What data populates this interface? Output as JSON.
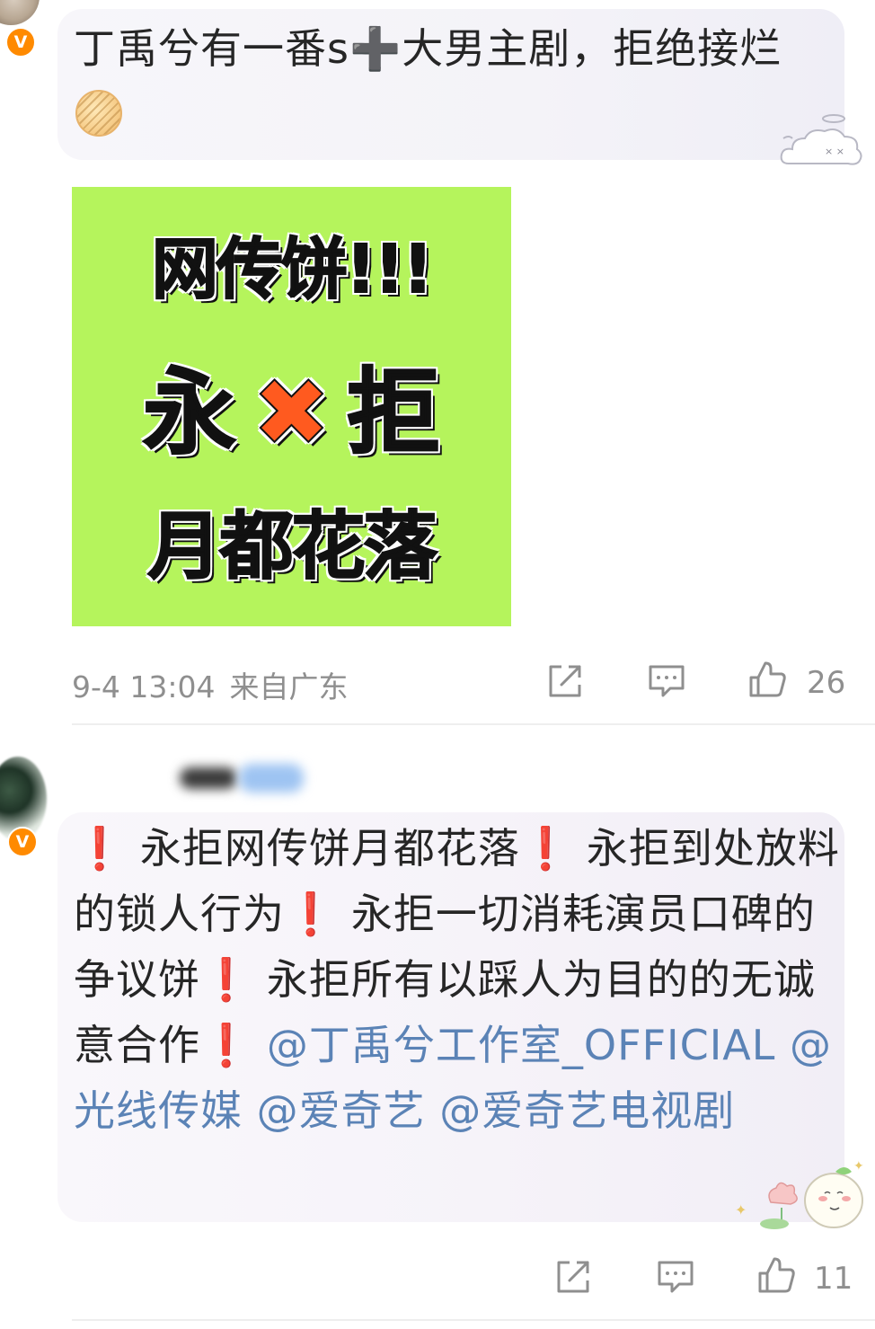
{
  "comments": [
    {
      "avatar_badge": "V",
      "text_parts": [
        "丁禹兮有一番s",
        "➕",
        "大男主剧，拒绝接烂"
      ],
      "emoji": "cookie-emoji",
      "image": {
        "line1": "网传饼!!!",
        "line2_left": "永",
        "line2_mark": "✖",
        "line2_right": "拒",
        "line3": "月都花落",
        "bg_color": "#b5f45c",
        "mark_color": "#ff5a1f"
      },
      "timestamp": "9-4 13:04",
      "location": "来自广东",
      "like_count": "26"
    },
    {
      "avatar_badge": "V",
      "segments": [
        "❗",
        "永拒网传饼月都花落",
        "❗",
        "永拒到处放料的锁人行为",
        "❗",
        "永拒一切消耗演员口碑的争议饼",
        "❗",
        "永拒所有以踩人为目的的无诚意合作",
        "❗",
        "@丁禹兮工作室_OFFICIAL",
        "@光线传媒",
        "@爱奇艺",
        "@爱奇艺电视剧"
      ],
      "like_count": "11"
    }
  ],
  "colors": {
    "mention": "#5b83b6",
    "exclamation": "#e02727",
    "meta_gray": "#8f8f8f",
    "badge_orange": "#ff8a00"
  },
  "icons": {
    "share": "share-icon",
    "comment": "comment-icon",
    "like": "thumbs-up-icon"
  }
}
